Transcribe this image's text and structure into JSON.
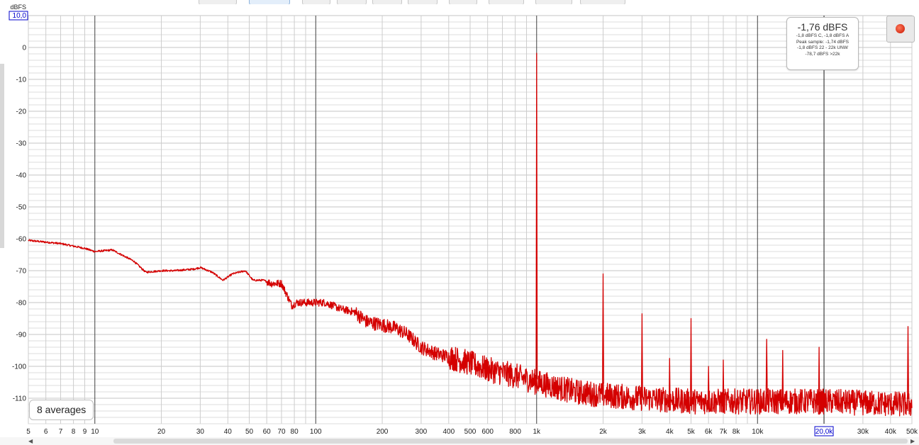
{
  "window": {
    "summary": {
      "level": "-1,76 dBFS",
      "lines": [
        "-1,8 dBFS C, -1,8 dBFS A",
        "Peak sample: -1,74 dBFS",
        "-1,8 dBFS 22 - 22k UNW",
        "-78,7 dBFS >22k"
      ]
    },
    "averages_label": "8 averages",
    "colors": {
      "trace": "#d40000",
      "grid_minor": "#dcdcdc",
      "grid_major": "#404040",
      "marker": "#0000cc"
    }
  },
  "chart_data": {
    "type": "line",
    "title": "",
    "xlabel": "",
    "ylabel": "dBFS",
    "xscale": "log",
    "xlim": [
      5,
      50000
    ],
    "ylim": [
      -118,
      10
    ],
    "y_top_label": "10,0",
    "x_cursor_label": "20,0k",
    "x_cursor_value": 20000,
    "yticks": [
      {
        "v": 0,
        "label": "0"
      },
      {
        "v": -10,
        "label": "-10"
      },
      {
        "v": -20,
        "label": "-20"
      },
      {
        "v": -30,
        "label": "-30"
      },
      {
        "v": -40,
        "label": "-40"
      },
      {
        "v": -50,
        "label": "-50"
      },
      {
        "v": -60,
        "label": "-60"
      },
      {
        "v": -70,
        "label": "-70"
      },
      {
        "v": -80,
        "label": "-80"
      },
      {
        "v": -90,
        "label": "-90"
      },
      {
        "v": -100,
        "label": "-100"
      },
      {
        "v": -110,
        "label": "-110"
      }
    ],
    "xticks": [
      {
        "v": 5,
        "label": "5"
      },
      {
        "v": 6,
        "label": "6"
      },
      {
        "v": 7,
        "label": "7"
      },
      {
        "v": 8,
        "label": "8"
      },
      {
        "v": 9,
        "label": "9"
      },
      {
        "v": 10,
        "label": "10"
      },
      {
        "v": 20,
        "label": "20"
      },
      {
        "v": 30,
        "label": "30"
      },
      {
        "v": 40,
        "label": "40"
      },
      {
        "v": 50,
        "label": "50"
      },
      {
        "v": 60,
        "label": "60"
      },
      {
        "v": 70,
        "label": "70"
      },
      {
        "v": 80,
        "label": "80"
      },
      {
        "v": 100,
        "label": "100"
      },
      {
        "v": 200,
        "label": "200"
      },
      {
        "v": 300,
        "label": "300"
      },
      {
        "v": 400,
        "label": "400"
      },
      {
        "v": 500,
        "label": "500"
      },
      {
        "v": 600,
        "label": "600"
      },
      {
        "v": 800,
        "label": "800"
      },
      {
        "v": 1000,
        "label": "1k"
      },
      {
        "v": 2000,
        "label": "2k"
      },
      {
        "v": 3000,
        "label": "3k"
      },
      {
        "v": 4000,
        "label": "4k"
      },
      {
        "v": 5000,
        "label": "5k"
      },
      {
        "v": 6000,
        "label": "6k"
      },
      {
        "v": 7000,
        "label": "7k"
      },
      {
        "v": 8000,
        "label": "8k"
      },
      {
        "v": 10000,
        "label": "10k"
      },
      {
        "v": 30000,
        "label": "30k"
      },
      {
        "v": 40000,
        "label": "40k"
      },
      {
        "v": 50000,
        "label": "50k"
      }
    ],
    "series": [
      {
        "noise_floor_x": [
          5,
          7,
          9,
          10,
          12,
          15,
          17,
          20,
          23,
          28,
          30,
          34,
          38,
          42,
          48,
          52,
          58,
          63,
          70,
          78,
          82,
          90,
          100,
          110,
          120,
          130,
          150,
          170,
          200,
          230,
          260,
          300,
          350,
          400,
          500,
          600,
          700,
          800,
          900,
          1000,
          1500,
          2000,
          3000,
          5000,
          10000,
          20000,
          50000
        ],
        "noise_floor_y": [
          -60.5,
          -61.5,
          -63,
          -64,
          -63.5,
          -67,
          -70.5,
          -70,
          -70,
          -69.5,
          -69,
          -70.5,
          -73,
          -71,
          -70,
          -73,
          -73,
          -74,
          -74,
          -81,
          -80,
          -80,
          -80,
          -80,
          -81,
          -82,
          -83,
          -86,
          -87,
          -88,
          -90,
          -94,
          -96,
          -97,
          -99,
          -101,
          -102,
          -103,
          -104,
          -105,
          -108,
          -109,
          -110,
          -111,
          -111,
          -111,
          -112
        ],
        "peaks": [
          {
            "x": 1000,
            "y": -1.8
          },
          {
            "x": 2000,
            "y": -71
          },
          {
            "x": 3000,
            "y": -83.5
          },
          {
            "x": 4000,
            "y": -97.5
          },
          {
            "x": 5000,
            "y": -85
          },
          {
            "x": 6000,
            "y": -100
          },
          {
            "x": 7000,
            "y": -98
          },
          {
            "x": 11000,
            "y": -91.5
          },
          {
            "x": 13000,
            "y": -95
          },
          {
            "x": 19000,
            "y": -94
          },
          {
            "x": 48000,
            "y": -87.5
          }
        ]
      }
    ]
  }
}
